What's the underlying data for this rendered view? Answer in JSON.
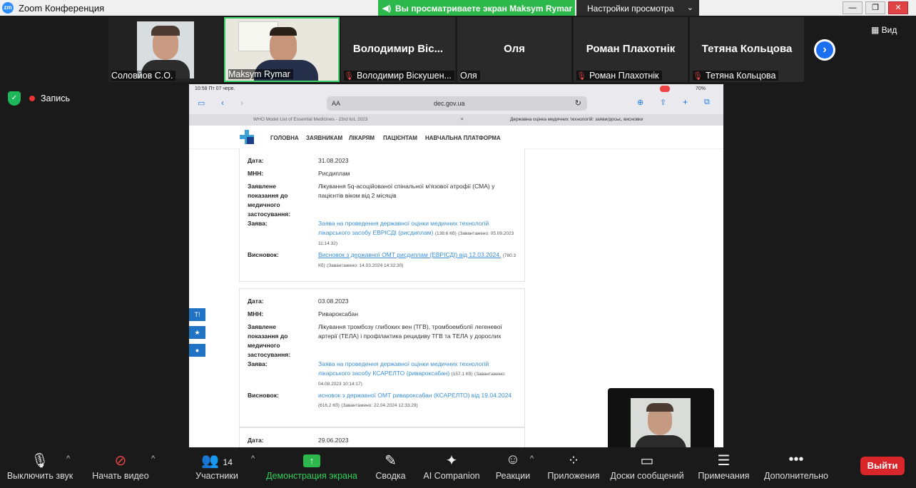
{
  "window": {
    "app_logo": "zm",
    "title": "Zoom Конференция",
    "share_banner": "Вы просматриваете экран Maksym Rymar",
    "view_settings": "Настройки просмотра",
    "controls": [
      "—",
      "❐",
      "✕"
    ]
  },
  "participants": [
    {
      "name": "Соловйов С.О.",
      "video": true,
      "muted": false
    },
    {
      "name": "Maksym Rymar",
      "video": true,
      "muted": false
    },
    {
      "display": "Володимир  Віс...",
      "name": "Володимир Віскушен...",
      "video": false,
      "muted": true
    },
    {
      "display": "Оля",
      "name": "Оля",
      "video": false,
      "muted": false
    },
    {
      "display": "Роман Плахотнік",
      "name": "Роман Плахотнік",
      "video": false,
      "muted": true
    },
    {
      "display": "Тетяна Кольцова",
      "name": "Тетяна Кольцова",
      "video": false,
      "muted": true
    }
  ],
  "view_button": "Вид",
  "recording": "Запись",
  "shared": {
    "status_time": "10:58  Пт 07 черв.",
    "status_right": "70%",
    "url_aa": "AA",
    "url": "dec.gov.ua",
    "tabs": [
      "WHO Model List of Essential Medicines - 23rd list, 2023",
      "Державна оцінка медичних технологій: заяви/досьє, висновки"
    ],
    "nav": [
      "ГОЛОВНА",
      "ЗАЯВНИКАМ",
      "ЛІКАРЯМ",
      "ПАЦІЄНТАМ",
      "НАВЧАЛЬНА ПЛАТФОРМА"
    ],
    "labels": {
      "date": "Дата:",
      "inn": "МНН:",
      "indication": "Заявлене показання до медичного застосування:",
      "application": "Заява:",
      "conclusion": "Висновок:"
    },
    "records": [
      {
        "date": "31.08.2023",
        "inn": "Рисдиплам",
        "indication": "Лікування 5q-асоційованої спінальної м'язової атрофії (СМА) у пацієнтів віком від 2 місяців",
        "application_link": "Заява на проведення державної оцінки медичних технологій лікарського засобу ЕВРІСДІ (рисдиплам)",
        "application_size": "(138.6 Кб)",
        "application_uploaded": "(Завантажено: 05.09.2023 11:14:32)",
        "conclusion_link": "Висновок з державної ОМТ рисдиплам (ЕВРІСДІ) від 12.03.2024.",
        "conclusion_size": "(780.3 Кб)",
        "conclusion_uploaded": "(Завантажено: 14.03.2024 14:32:30)"
      },
      {
        "date": "03.08.2023",
        "inn": "Ривароксабан",
        "indication": "Лікування тромбозу глибоких вен (ТГВ), тромбоемболії легеневої артерії (ТЕЛА) і профілактика рецидиву ТГВ та ТЕЛА у дорослих",
        "application_link": "Заява на проведення державної оцінки медичних технологій лікарського засобу КСАРЕЛТО (ривароксабан)",
        "application_size": "(157.1 Кб)",
        "application_uploaded": "(Завантажено: 04.08.2023 10:14:17)",
        "conclusion_link": "исновок з державної ОМТ ривароксабан (КСАРЕЛТО) від 19.04.2024",
        "conclusion_size": "(616.2 Кб)",
        "conclusion_uploaded": "(Завантажено: 22.04.2024 12:33:29)"
      },
      {
        "date": "29.06.2023"
      }
    ],
    "side_buttons": [
      "T!",
      "★",
      "●"
    ]
  },
  "toolbar": {
    "mute": "Выключить звук",
    "video": "Начать видео",
    "participants": "Участники",
    "participants_count": "14",
    "share": "Демонстрация экрана",
    "summary": "Сводка",
    "ai": "AI Companion",
    "reactions": "Реакции",
    "apps": "Приложения",
    "whiteboards": "Доски сообщений",
    "notes": "Примечания",
    "more": "Дополнительно",
    "leave": "Выйти"
  },
  "colors": {
    "share_green": "#2db84b",
    "leave_red": "#d9262b",
    "link_blue": "#3a8fd6",
    "zoom_blue": "#2d8cff"
  }
}
